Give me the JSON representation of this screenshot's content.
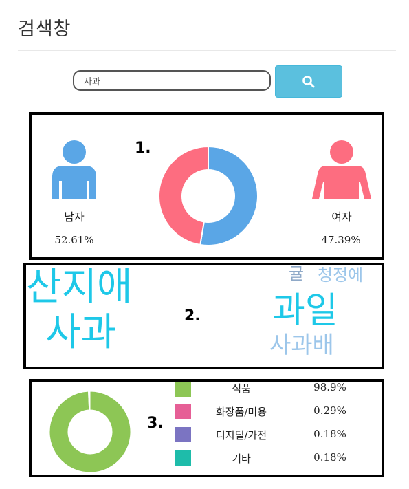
{
  "page": {
    "title": "검색창"
  },
  "search": {
    "value": "사과",
    "button_icon": "search-icon"
  },
  "panel1": {
    "number": "1.",
    "male": {
      "label": "남자",
      "percent": "52.61%",
      "value": 52.61,
      "color": "#5aa6e6",
      "icon": "male-person-icon"
    },
    "female": {
      "label": "여자",
      "percent": "47.39%",
      "value": 47.39,
      "color": "#fd6d80",
      "icon": "female-person-icon"
    }
  },
  "panel2": {
    "number": "2.",
    "words": [
      {
        "text": "산지애",
        "color": "#1ec8e8"
      },
      {
        "text": "사과",
        "color": "#1ec8e8"
      },
      {
        "text": "과일",
        "color": "#1ec8e8"
      },
      {
        "text": "사과배",
        "color": "#9cc6ea"
      },
      {
        "text": "귤",
        "color": "#8fa9c8"
      },
      {
        "text": "청정에",
        "color": "#9cc6ea"
      }
    ]
  },
  "panel3": {
    "number": "3.",
    "categories": [
      {
        "label": "식품",
        "percent": "98.9%",
        "value": 98.9,
        "color": "#8dc655"
      },
      {
        "label": "화장품/미용",
        "percent": "0.29%",
        "value": 0.29,
        "color": "#e65f96"
      },
      {
        "label": "디지털/가전",
        "percent": "0.18%",
        "value": 0.18,
        "color": "#7b74c2"
      },
      {
        "label": "기타",
        "percent": "0.18%",
        "value": 0.18,
        "color": "#1ebcaa"
      }
    ]
  },
  "chart_data": [
    {
      "type": "pie",
      "categories": [
        "남자",
        "여자"
      ],
      "values": [
        52.61,
        47.39
      ],
      "colors": [
        "#5aa6e6",
        "#fd6d80"
      ]
    },
    {
      "type": "pie",
      "categories": [
        "식품",
        "화장품/미용",
        "디지털/가전",
        "기타"
      ],
      "values": [
        98.9,
        0.29,
        0.18,
        0.18
      ],
      "colors": [
        "#8dc655",
        "#e65f96",
        "#7b74c2",
        "#1ebcaa"
      ]
    }
  ]
}
